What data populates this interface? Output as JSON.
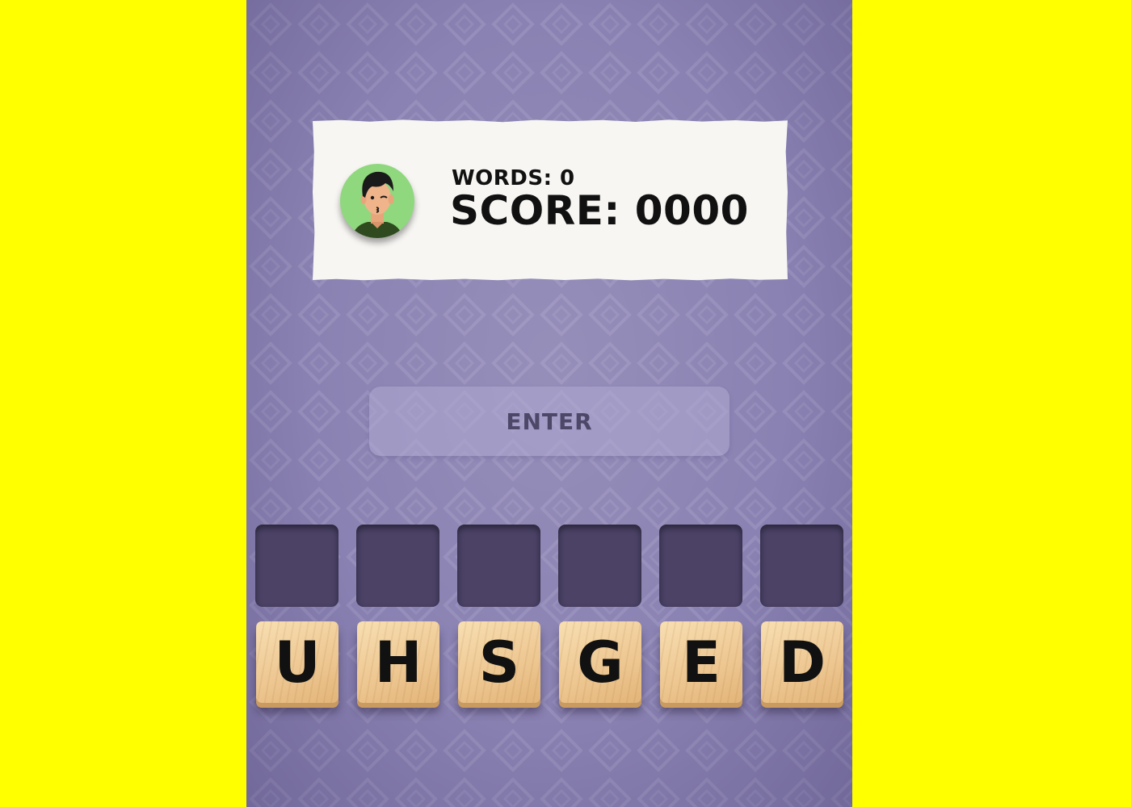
{
  "score_card": {
    "words_text": "WORDS: 0",
    "score_text": "SCORE: 0000"
  },
  "enter_button": {
    "label": "ENTER"
  },
  "letter_tiles": [
    "U",
    "H",
    "S",
    "G",
    "E",
    "D"
  ],
  "colors": {
    "page_background": "#ffff00",
    "game_background": "#8a82b2",
    "slot": "#4b4266",
    "tile": "#eec893",
    "avatar_background": "#8fd87e"
  }
}
